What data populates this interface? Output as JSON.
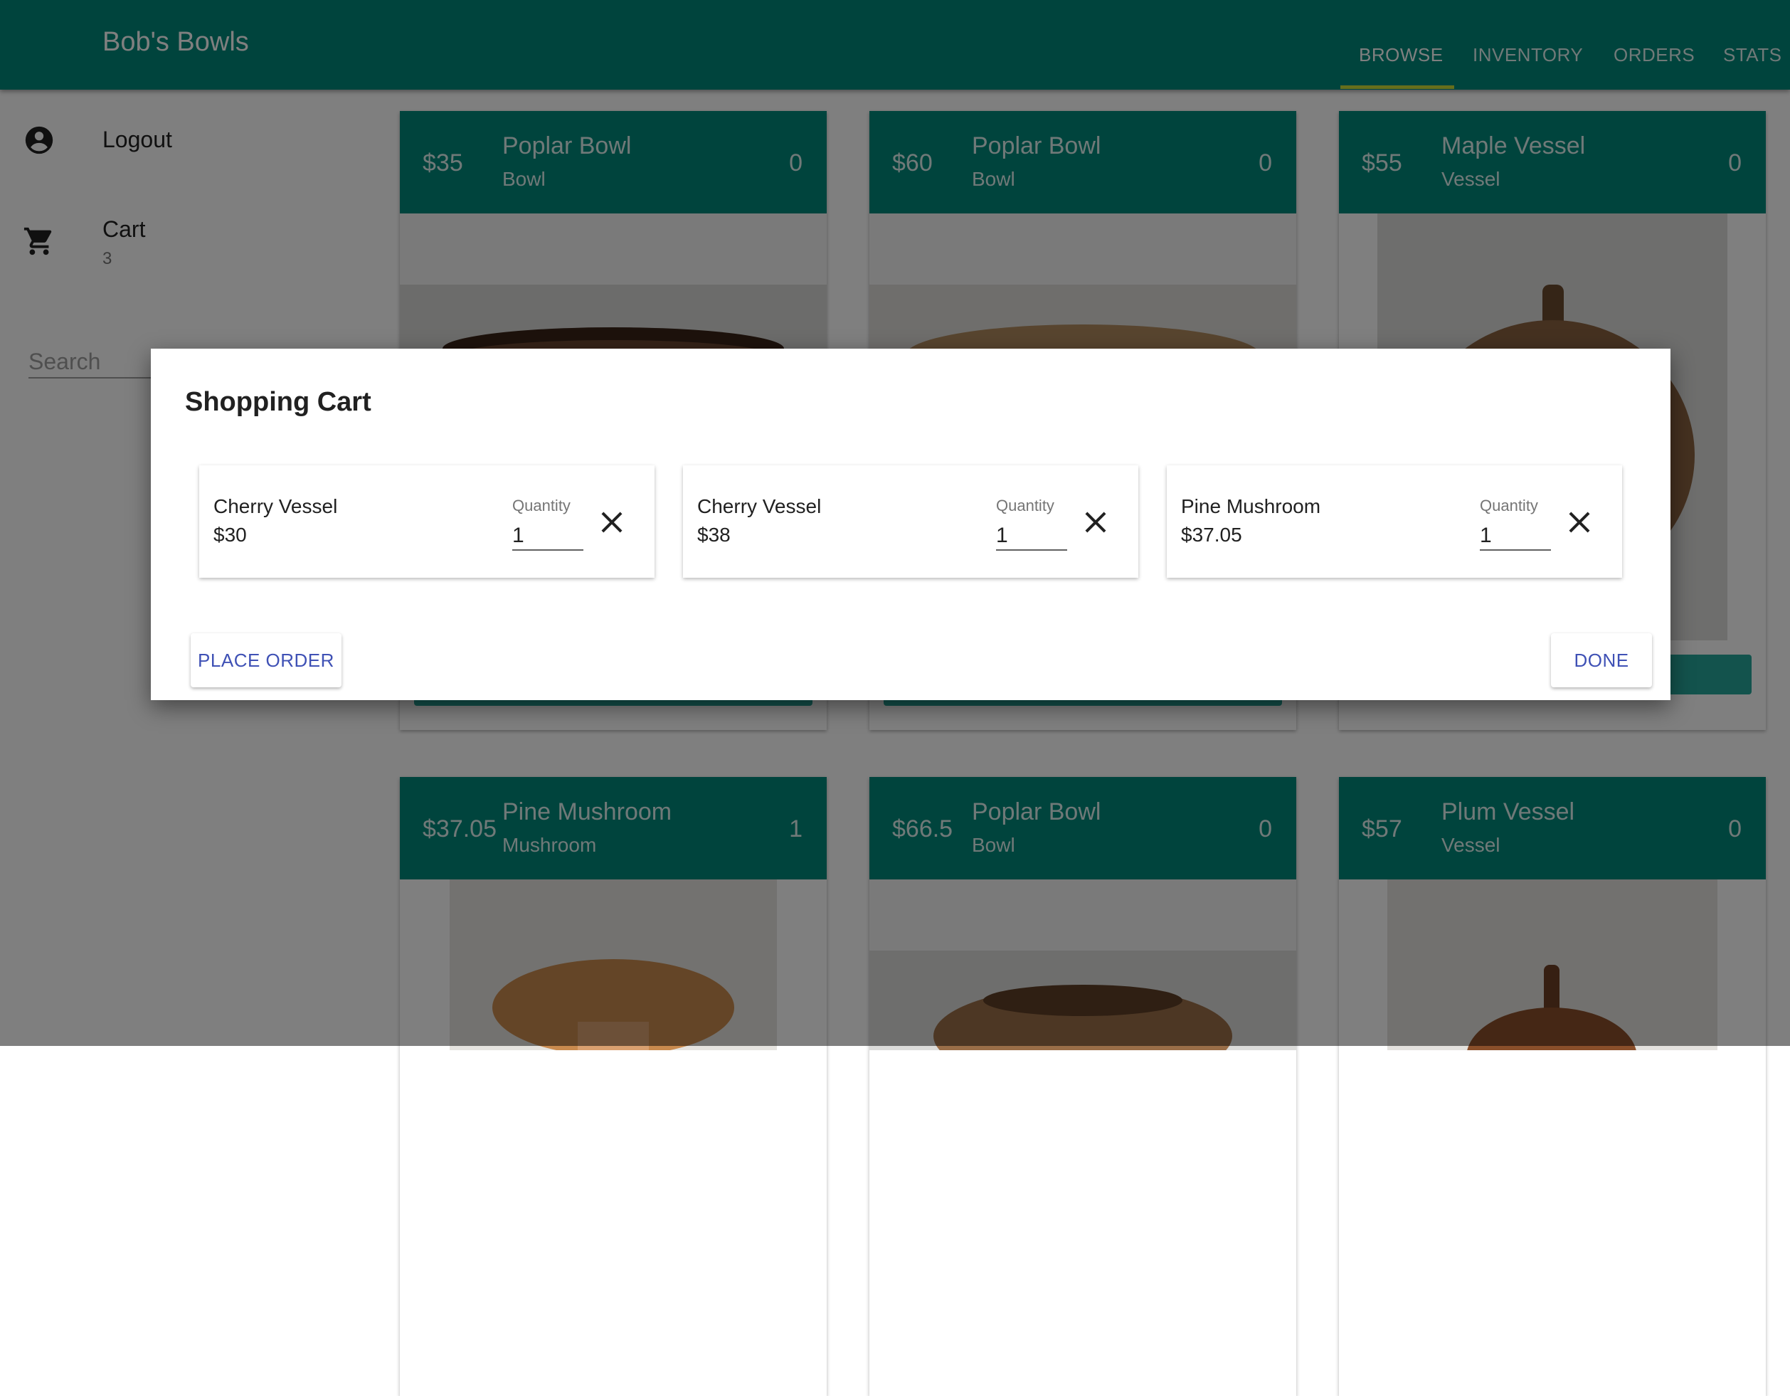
{
  "app": {
    "title": "Bob's Bowls"
  },
  "nav": {
    "tabs": [
      {
        "label": "BROWSE",
        "active": true
      },
      {
        "label": "INVENTORY",
        "active": false
      },
      {
        "label": "ORDERS",
        "active": false
      },
      {
        "label": "STATS",
        "active": false
      }
    ]
  },
  "sidebar": {
    "logout": {
      "label": "Logout",
      "icon": "account-circle-icon"
    },
    "cart": {
      "label": "Cart",
      "count": "3",
      "icon": "shopping-cart-icon"
    },
    "search": {
      "placeholder": "Search",
      "value": ""
    }
  },
  "products": [
    {
      "price": "$35",
      "name": "Poplar Bowl",
      "type": "Bowl",
      "count": "0"
    },
    {
      "price": "$60",
      "name": "Poplar Bowl",
      "type": "Bowl",
      "count": "0"
    },
    {
      "price": "$55",
      "name": "Maple Vessel",
      "type": "Vessel",
      "count": "0"
    },
    {
      "price": "$37.05",
      "name": "Pine Mushroom",
      "type": "Mushroom",
      "count": "1"
    },
    {
      "price": "$66.5",
      "name": "Poplar Bowl",
      "type": "Bowl",
      "count": "0"
    },
    {
      "price": "$57",
      "name": "Plum Vessel",
      "type": "Vessel",
      "count": "0"
    }
  ],
  "dialog": {
    "title": "Shopping Cart",
    "quantity_label": "Quantity",
    "items": [
      {
        "name": "Cherry Vessel",
        "price": "$30",
        "quantity": "1"
      },
      {
        "name": "Cherry Vessel",
        "price": "$38",
        "quantity": "1"
      },
      {
        "name": "Pine Mushroom",
        "price": "$37.05",
        "quantity": "1"
      }
    ],
    "place_order_label": "PLACE ORDER",
    "done_label": "DONE"
  },
  "colors": {
    "primary": "#00897b",
    "accent": "#cddc39",
    "button_text": "#3f51b5"
  }
}
